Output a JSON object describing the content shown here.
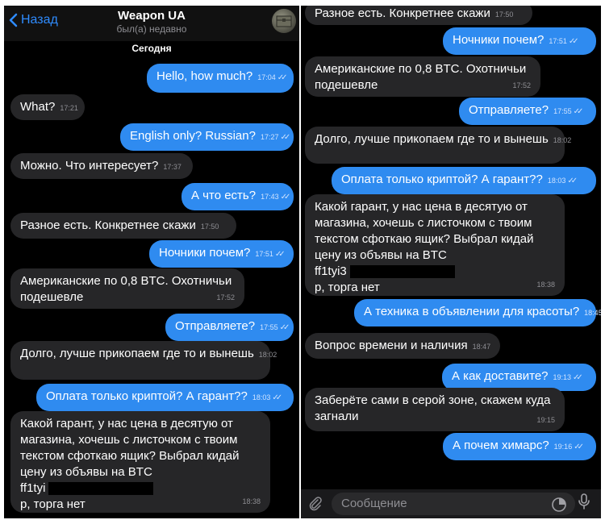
{
  "header": {
    "back_label": "Назад",
    "title": "Weapon UA",
    "status": "был(а) недавно"
  },
  "date_label": "Сегодня",
  "composer": {
    "placeholder": "Сообщение"
  },
  "colors": {
    "outgoing": "#2f8bf0",
    "incoming": "#262628",
    "accent": "#2f8cff"
  },
  "left_messages": [
    {
      "dir": "out",
      "text": "Hello, how much?",
      "time": "17:04"
    },
    {
      "dir": "in",
      "text": "What?",
      "time": "17:21"
    },
    {
      "dir": "out",
      "text": "English only? Russian?",
      "time": "17:27"
    },
    {
      "dir": "in",
      "text": "Можно. Что интересует?",
      "time": "17:37"
    },
    {
      "dir": "out",
      "text": "А что есть?",
      "time": "17:43"
    },
    {
      "dir": "in",
      "text": "Разное есть. Конкретнее скажи",
      "time": "17:50"
    },
    {
      "dir": "out",
      "text": "Ночники почем?",
      "time": "17:51"
    },
    {
      "dir": "in",
      "lines": [
        "Американские по 0,8 BTC. Охотничьи",
        "подешевле"
      ],
      "time": "17:52"
    },
    {
      "dir": "out",
      "text": "Отправляете?",
      "time": "17:55"
    },
    {
      "dir": "in",
      "text": "Долго, лучше прикопаем где то и вынешь",
      "time": "18:02"
    },
    {
      "dir": "out",
      "text": "Оплата только криптой? А гарант??",
      "time": "18:03"
    },
    {
      "dir": "in",
      "lines": [
        "Какой гарант, у нас цена в десятую от",
        "магазина, хочешь с листочком с твоим",
        "текстом сфоткаю ящик? Выбрал кидай",
        "цену из объявы на BTC",
        "ff1tyi",
        "р, торга нет"
      ],
      "time": "18:38"
    }
  ],
  "right_messages": [
    {
      "dir": "in",
      "text": "Разное есть. Конкретнее скажи",
      "time": "17:50"
    },
    {
      "dir": "out",
      "text": "Ночники почем?",
      "time": "17:51"
    },
    {
      "dir": "in",
      "lines": [
        "Американские по 0,8 BTC. Охотничьи",
        "подешевле"
      ],
      "time": "17:52"
    },
    {
      "dir": "out",
      "text": "Отправляете?",
      "time": "17:55"
    },
    {
      "dir": "in",
      "text": "Долго, лучше прикопаем где то и вынешь",
      "time": "18:02"
    },
    {
      "dir": "out",
      "text": "Оплата только криптой? А гарант??",
      "time": "18:03"
    },
    {
      "dir": "in",
      "lines": [
        "Какой гарант, у нас цена в десятую от",
        "магазина, хочешь с листочком с твоим",
        "текстом сфоткаю ящик? Выбрал кидай",
        "цену из объявы на BTC",
        "ff1tyi3",
        "р, торга нет"
      ],
      "time": "18:38"
    },
    {
      "dir": "out",
      "text": "А техника в объявлении для красоты?",
      "time": "18:45"
    },
    {
      "dir": "in",
      "text": "Вопрос времени и наличия",
      "time": "18:47"
    },
    {
      "dir": "out",
      "text": "А как доставите?",
      "time": "19:13"
    },
    {
      "dir": "in",
      "lines": [
        "Заберёте сами в серой зоне, скажем куда",
        "загнали"
      ],
      "time": "19:15"
    },
    {
      "dir": "out",
      "text": "А почем химарс?",
      "time": "19:16"
    }
  ]
}
